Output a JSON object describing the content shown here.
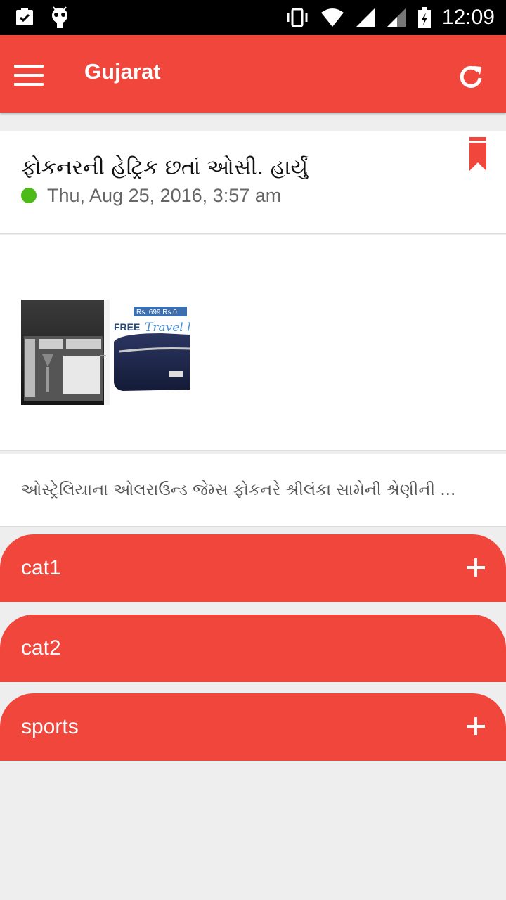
{
  "status_bar": {
    "time": "12:09"
  },
  "app_bar": {
    "title": "Gujarat"
  },
  "article": {
    "headline": "ફોકનરની હેટ્રિક છતાં ઓસી. હાર્યું",
    "datetime": "Thu, Aug 25, 2016, 3:57 am",
    "summary": "ઓસ્ટ્રેલિયાના ઓલરાઉન્ડ જેમ્સ ફોકનરે શ્રીલંકા સામેની શ્રેણીની ...",
    "ad": {
      "price_tag": "Rs. 699 Rs.0",
      "free_text": "FREE",
      "script_text": "Travel k"
    }
  },
  "categories": [
    {
      "label": "cat1"
    },
    {
      "label": "cat2"
    },
    {
      "label": "sports"
    }
  ],
  "colors": {
    "accent": "#f0463c",
    "status_dot": "#4cbb17",
    "background": "#eeeeee"
  }
}
